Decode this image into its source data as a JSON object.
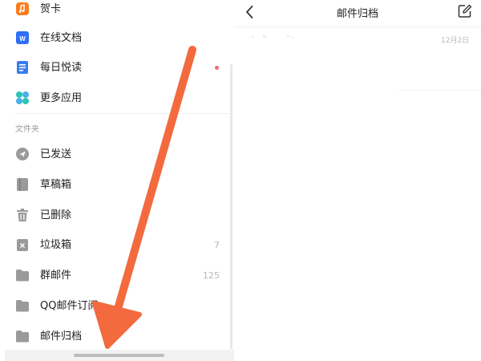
{
  "sidebar": {
    "items": [
      {
        "label": "贺卡",
        "icon": "card-icon",
        "count": ""
      },
      {
        "label": "在线文档",
        "icon": "doc-w-icon",
        "count": ""
      },
      {
        "label": "每日悦读",
        "icon": "reading-icon",
        "count": ""
      },
      {
        "label": "更多应用",
        "icon": "apps-icon",
        "count": ""
      }
    ],
    "folder_section_label": "文件夹",
    "folders": [
      {
        "label": "已发送",
        "icon": "sent-icon",
        "count": ""
      },
      {
        "label": "草稿箱",
        "icon": "draft-icon",
        "count": ""
      },
      {
        "label": "已删除",
        "icon": "trash-icon",
        "count": ""
      },
      {
        "label": "垃圾箱",
        "icon": "spam-icon",
        "count": "7"
      },
      {
        "label": "群邮件",
        "icon": "folder-icon",
        "count": "125"
      },
      {
        "label": "QQ邮件订阅",
        "icon": "folder-icon",
        "count": ""
      },
      {
        "label": "邮件归档",
        "icon": "folder-icon",
        "count": ""
      }
    ]
  },
  "main": {
    "title": "邮件归档",
    "mail_date": "12月2日"
  },
  "colors": {
    "accent_orange": "#ff7a1a",
    "doc_blue": "#2f6ef5",
    "teal": "#2ec4b6",
    "arrow": "#f26a3d",
    "icon_gray": "#9a9a9a"
  }
}
